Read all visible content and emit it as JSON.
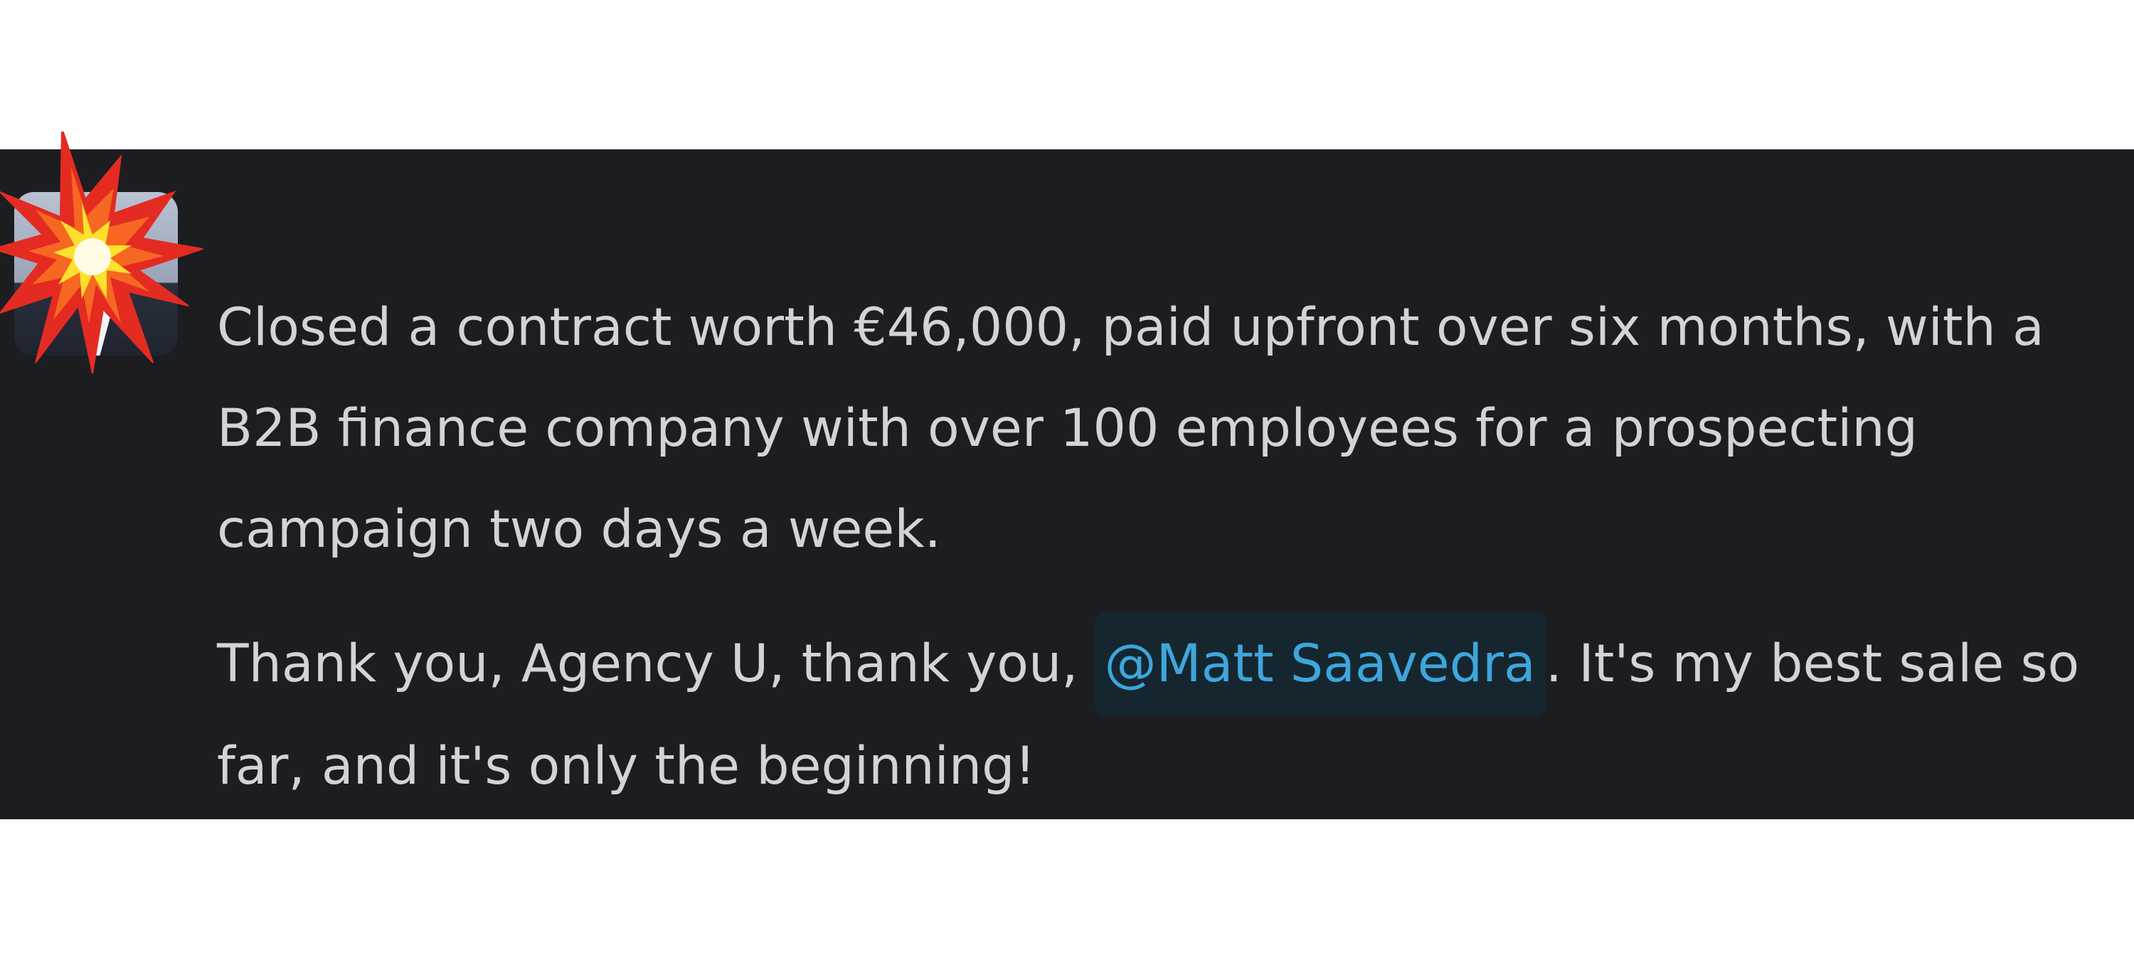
{
  "message": {
    "avatar": {
      "icon": "collision-icon",
      "colors": {
        "panel": "#1c1d20",
        "text": "#d2d3d6",
        "mention_text": "#3ea6dc",
        "mention_bg": "#15262f"
      }
    },
    "paragraph1": "Closed a contract worth €46,000, paid upfront over six months, with a B2B finance company with over 100 employees for a prospecting campaign two days a week.",
    "paragraph2_before": "Thank you, Agency U, thank you, ",
    "mention": "@Matt Saavedra",
    "paragraph2_after": ". It's my best sale so far, and it's only the beginning!"
  }
}
